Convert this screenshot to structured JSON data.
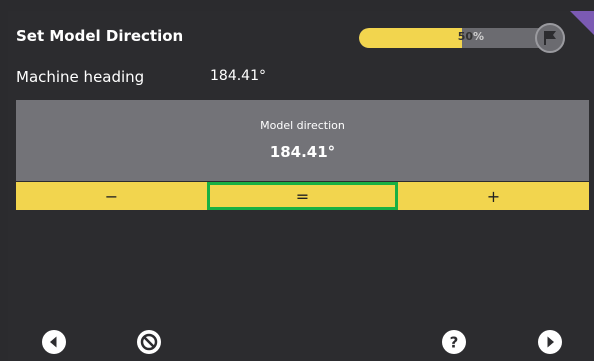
{
  "header": {
    "title": "Set Model Direction",
    "progress": {
      "value": 0.5,
      "text": "50",
      "percent_sign": "%"
    }
  },
  "heading": {
    "label": "Machine heading",
    "value": "184.41°"
  },
  "direction": {
    "label": "Model direction",
    "value": "184.41°"
  },
  "controls": {
    "minus_label": "−",
    "equals_label": "=",
    "plus_label": "+"
  },
  "icons": {
    "flag": "flag-icon",
    "back": "back-arrow-icon",
    "cancel": "cancel-icon",
    "help": "help-icon",
    "next": "next-arrow-icon"
  },
  "colors": {
    "accent_yellow": "#f2d54e",
    "selected_outline": "#19b043",
    "panel_gray": "#737378",
    "corner_purple": "#7b5ab3"
  }
}
